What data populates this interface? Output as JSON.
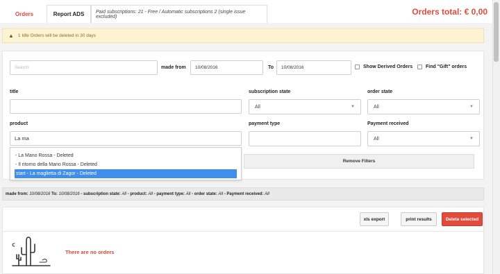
{
  "tabs": [
    {
      "label": "Orders",
      "active": true
    },
    {
      "label": "Report ADS",
      "active": false
    }
  ],
  "subscriptions_info": "Paid subscriptions: 21 - Free / Automatic subscriptions 2 (single issue excluded)",
  "orders_total": "Orders total: € 0,00",
  "warning": "1 Idle Orders will be deleted in 30 days",
  "filters": {
    "search_placeholder": "Search",
    "made_from_label": "made from",
    "made_from_value": "10/08/2016",
    "to_label": "To",
    "to_value": "10/08/2016",
    "show_derived_label": "Show Derived Orders",
    "find_gift_label": "Find \"Gift\" orders",
    "title_label": "title",
    "title_value": "",
    "subscription_state_label": "subscription state",
    "subscription_state_value": "All",
    "order_state_label": "order state",
    "order_state_value": "All",
    "product_label": "product",
    "product_value": "La ma",
    "payment_type_label": "payment type",
    "payment_type_value": "",
    "payment_received_label": "Payment received",
    "payment_received_value": "All",
    "remove_filters_label": "Remove Filters"
  },
  "autocomplete": [
    {
      "label": "- La Mano Rossa - Deleted",
      "highlighted": false
    },
    {
      "label": "- Il ritorno della Mano Rossa - Deleted",
      "highlighted": false
    },
    {
      "label": "start - La maglietta di Zagor - Deleted",
      "highlighted": true
    }
  ],
  "summary": [
    {
      "key": "made from:",
      "value": "10/08/2016"
    },
    {
      "key": "To:",
      "value": "10/08/2016"
    },
    {
      "key": "- subscription state:",
      "value": "All"
    },
    {
      "key": "- product:",
      "value": "All"
    },
    {
      "key": "- payment type:",
      "value": "All"
    },
    {
      "key": "- order state:",
      "value": "All"
    },
    {
      "key": "- Payment received:",
      "value": "All"
    }
  ],
  "actions": {
    "xls_export": "xls export",
    "print_results": "print results",
    "delete_selected": "Delete selected"
  },
  "empty_message": "There are no orders",
  "colors": {
    "accent_red": "#e14b3b",
    "highlight_blue": "#3f8ee9",
    "warning_bg": "#fcf3d2"
  }
}
